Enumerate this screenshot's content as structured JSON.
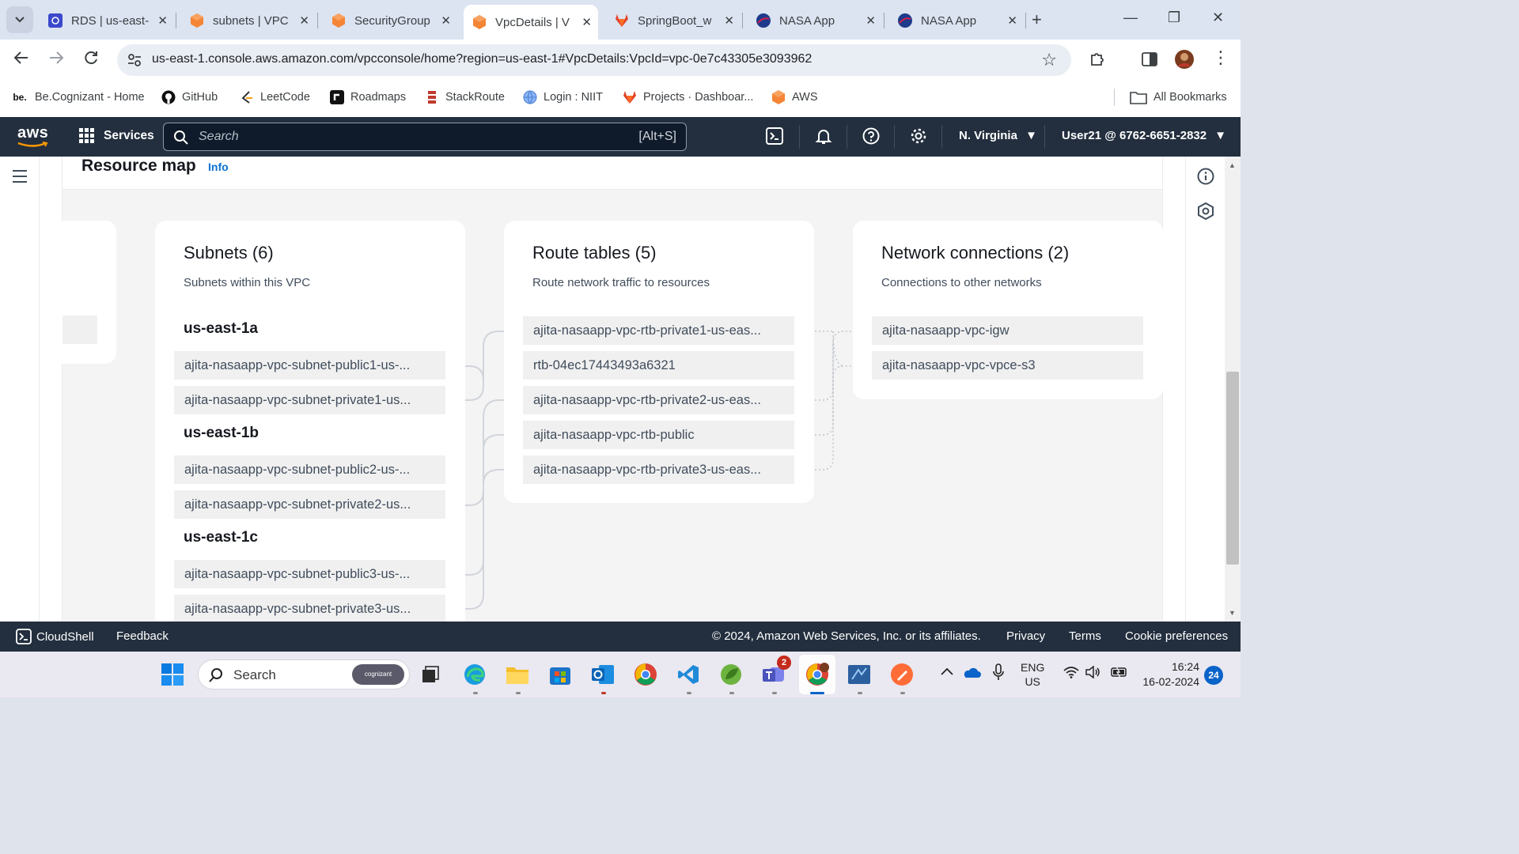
{
  "browser": {
    "tabs": [
      {
        "title": "RDS | us-east-",
        "icon": "rds-icon",
        "active": false
      },
      {
        "title": "subnets | VPC",
        "icon": "aws-cube-icon",
        "active": false
      },
      {
        "title": "SecurityGroup",
        "icon": "aws-cube-icon",
        "active": false
      },
      {
        "title": "VpcDetails | V",
        "icon": "aws-cube-icon",
        "active": true
      },
      {
        "title": "SpringBoot_w",
        "icon": "gitlab-icon",
        "active": false
      },
      {
        "title": "NASA App",
        "icon": "nasa-icon",
        "active": false
      },
      {
        "title": "NASA App",
        "icon": "nasa-icon",
        "active": false
      }
    ],
    "url": "us-east-1.console.aws.amazon.com/vpcconsole/home?region=us-east-1#VpcDetails:VpcId=vpc-0e7c43305e3093962",
    "bookmarks": [
      {
        "label": "Be.Cognizant - Home",
        "icon": "be-icon"
      },
      {
        "label": "GitHub",
        "icon": "github-icon"
      },
      {
        "label": "LeetCode",
        "icon": "leetcode-icon"
      },
      {
        "label": "Roadmaps",
        "icon": "roadmaps-icon"
      },
      {
        "label": "StackRoute",
        "icon": "stackroute-icon"
      },
      {
        "label": "Login : NIIT",
        "icon": "globe-icon"
      },
      {
        "label": "Projects · Dashboar...",
        "icon": "gitlab-icon"
      },
      {
        "label": "AWS",
        "icon": "aws-cube-icon"
      }
    ],
    "all_bookmarks": "All Bookmarks"
  },
  "aws": {
    "logo": "aws",
    "services": "Services",
    "search_placeholder": "Search",
    "search_shortcut": "[Alt+S]",
    "region": "N. Virginia",
    "account": "User21 @ 6762-6651-2832"
  },
  "resource_map": {
    "title": "Resource map",
    "info": "Info",
    "subnets": {
      "title": "Subnets (6)",
      "subtitle": "Subnets within this VPC",
      "zones": [
        {
          "name": "us-east-1a",
          "items": [
            "ajita-nasaapp-vpc-subnet-public1-us-...",
            "ajita-nasaapp-vpc-subnet-private1-us..."
          ]
        },
        {
          "name": "us-east-1b",
          "items": [
            "ajita-nasaapp-vpc-subnet-public2-us-...",
            "ajita-nasaapp-vpc-subnet-private2-us..."
          ]
        },
        {
          "name": "us-east-1c",
          "items": [
            "ajita-nasaapp-vpc-subnet-public3-us-...",
            "ajita-nasaapp-vpc-subnet-private3-us..."
          ]
        }
      ]
    },
    "route_tables": {
      "title": "Route tables (5)",
      "subtitle": "Route network traffic to resources",
      "items": [
        "ajita-nasaapp-vpc-rtb-private1-us-eas...",
        "rtb-04ec17443493a6321",
        "ajita-nasaapp-vpc-rtb-private2-us-eas...",
        "ajita-nasaapp-vpc-rtb-public",
        "ajita-nasaapp-vpc-rtb-private3-us-eas..."
      ]
    },
    "network_connections": {
      "title": "Network connections (2)",
      "subtitle": "Connections to other networks",
      "items": [
        "ajita-nasaapp-vpc-igw",
        "ajita-nasaapp-vpc-vpce-s3"
      ]
    }
  },
  "footer": {
    "cloudshell": "CloudShell",
    "feedback": "Feedback",
    "copyright": "© 2024, Amazon Web Services, Inc. or its affiliates.",
    "privacy": "Privacy",
    "terms": "Terms",
    "cookies": "Cookie preferences"
  },
  "taskbar": {
    "search_placeholder": "Search",
    "search_badge": "cognizant",
    "teams_badge": "2",
    "lang_top": "ENG",
    "lang_bottom": "US",
    "time": "16:24",
    "date": "16-02-2024",
    "notifications": "24"
  },
  "colors": {
    "aws_nav": "#232f3e",
    "aws_orange": "#ff9900",
    "link_blue": "#0972d3",
    "chrome_frame": "#dce3f1"
  }
}
